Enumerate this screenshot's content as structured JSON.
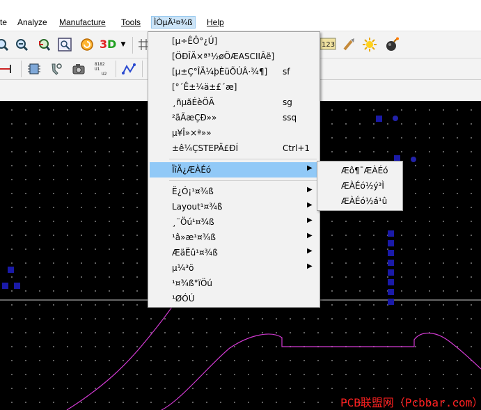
{
  "menubar": {
    "items": [
      {
        "label": "te"
      },
      {
        "label": "Analyze"
      },
      {
        "label": "Manufacture"
      },
      {
        "label": "Tools"
      },
      {
        "label": "ÌÒµÄ¹¤¾ß"
      },
      {
        "label": "Help"
      }
    ]
  },
  "toolbar": {
    "counter_label": "123",
    "small_label_lines": [
      "8182",
      "U1",
      "U2"
    ]
  },
  "main_menu": {
    "items": [
      {
        "label": "[µ÷ÊÔ°¿Ú]",
        "shortcut": ""
      },
      {
        "label": "[ÖÐÎÄ×ª³½øÖÆASCIIÂë]",
        "shortcut": ""
      },
      {
        "label": "[µ±Ç°ÎÄ¼þÈüÕÚÂ·¾¶]",
        "shortcut": "sf"
      },
      {
        "label": "[°´Ê±¼ä±£´æ]",
        "shortcut": ""
      },
      {
        "label": "¸ñµãÉèÖÃ",
        "shortcut": "sg"
      },
      {
        "label": "²ãÃæÇÐ»»",
        "shortcut": "ssq"
      },
      {
        "label": "µ¥Î»×ª»»",
        "shortcut": ""
      },
      {
        "label": "±ê¼ÇSTEPÄ£ÐÍ",
        "shortcut": "Ctrl+1"
      },
      {
        "label": "ÏîÄ¿ÆÀÉó",
        "shortcut": ""
      },
      {
        "label": "Ë¿Ó¡¹¤¾ß",
        "shortcut": ""
      },
      {
        "label": "Layout¹¤¾ß",
        "shortcut": ""
      },
      {
        "label": "¸¨Öú¹¤¾ß",
        "shortcut": ""
      },
      {
        "label": "¹â»æ¹¤¾ß",
        "shortcut": ""
      },
      {
        "label": "ÆäËû¹¤¾ß",
        "shortcut": ""
      },
      {
        "label": "µ¼³ö",
        "shortcut": ""
      },
      {
        "label": "¹¤¾ß°ïÖú",
        "shortcut": ""
      },
      {
        "label": "¹ØÓÚ",
        "shortcut": ""
      }
    ]
  },
  "sub_menu": {
    "items": [
      {
        "label": "Æô¶¯ÆÀÉó"
      },
      {
        "label": "ÆÀÉó½ý³Ì"
      },
      {
        "label": "ÆÀÉó½á¹û"
      }
    ]
  },
  "watermark": "PCB联盟网（Pcbbar.com）",
  "colors": {
    "highlight": "#91c9f7",
    "trace": "#d23ad2",
    "pad": "#1a1aa8",
    "watermark": "#ff2020"
  }
}
